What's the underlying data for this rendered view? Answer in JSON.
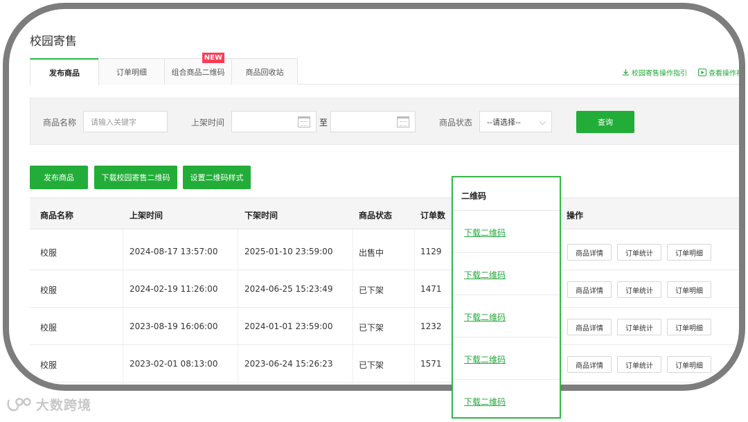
{
  "page": {
    "title": "校园寄售"
  },
  "tabs": [
    {
      "label": "发布商品",
      "active": true
    },
    {
      "label": "订单明细"
    },
    {
      "label": "组合商品二维码",
      "badge": "NEW"
    },
    {
      "label": "商品回收站"
    }
  ],
  "guides": {
    "guide_link": "校园寄售操作指引",
    "video_link": "查看操作视频"
  },
  "filter": {
    "name_label": "商品名称",
    "name_placeholder": "请输入关键字",
    "time_label": "上架时间",
    "to_label": "至",
    "status_label": "商品状态",
    "status_value": "--请选择--",
    "search_button": "查询"
  },
  "actions": {
    "publish": "发布商品",
    "download_qr": "下载校园寄售二维码",
    "qr_style": "设置二维码样式"
  },
  "table": {
    "headers": [
      "商品名称",
      "上架时间",
      "下架时间",
      "商品状态",
      "订单数",
      "操作"
    ],
    "rows": [
      {
        "name": "校服",
        "on": "2024-08-17 13:57:00",
        "off": "2025-01-10 23:59:00",
        "status": "出售中",
        "orders": "1129"
      },
      {
        "name": "校服",
        "on": "2024-02-19 11:26:00",
        "off": "2024-06-25 15:23:49",
        "status": "已下架",
        "orders": "1471"
      },
      {
        "name": "校服",
        "on": "2023-08-19 16:06:00",
        "off": "2024-01-01 23:59:00",
        "status": "已下架",
        "orders": "1232"
      },
      {
        "name": "校服",
        "on": "2023-02-01 08:13:00",
        "off": "2023-06-24 15:26:23",
        "status": "已下架",
        "orders": "1571"
      }
    ],
    "op_labels": {
      "detail": "商品详情",
      "stats": "订单统计",
      "orders": "订单明细"
    }
  },
  "qr_column": {
    "header": "二维码",
    "links": [
      "下载二维码",
      "下载二维码",
      "下载二维码",
      "下载二维码",
      "下载二维码"
    ]
  },
  "watermark": {
    "text": "大数跨境"
  },
  "colors": {
    "accent": "#22ad38",
    "badge": "#ff3b55",
    "frame": "#7d7d7d"
  }
}
